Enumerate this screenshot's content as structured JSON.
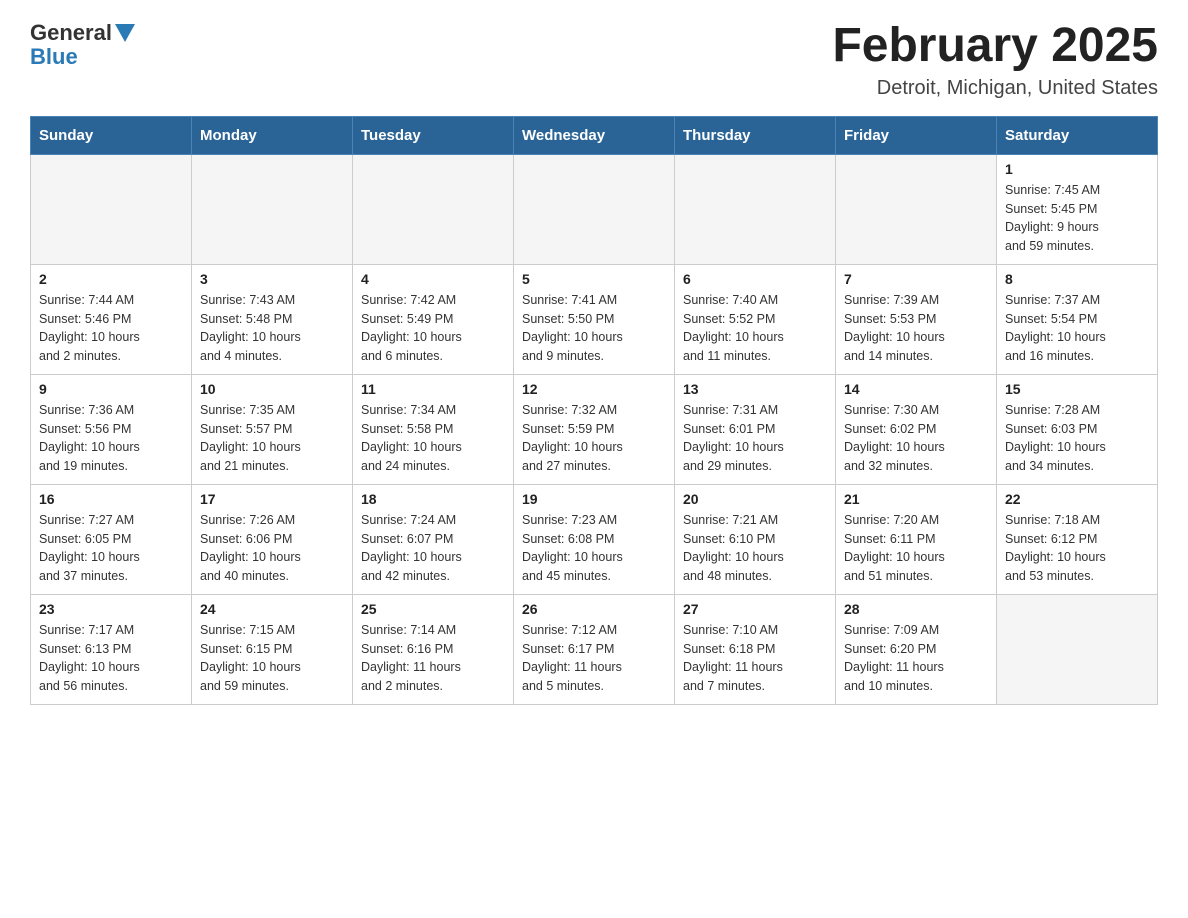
{
  "logo": {
    "general": "General",
    "blue": "Blue"
  },
  "header": {
    "title": "February 2025",
    "location": "Detroit, Michigan, United States"
  },
  "weekdays": [
    "Sunday",
    "Monday",
    "Tuesday",
    "Wednesday",
    "Thursday",
    "Friday",
    "Saturday"
  ],
  "weeks": [
    [
      {
        "day": "",
        "info": ""
      },
      {
        "day": "",
        "info": ""
      },
      {
        "day": "",
        "info": ""
      },
      {
        "day": "",
        "info": ""
      },
      {
        "day": "",
        "info": ""
      },
      {
        "day": "",
        "info": ""
      },
      {
        "day": "1",
        "info": "Sunrise: 7:45 AM\nSunset: 5:45 PM\nDaylight: 9 hours\nand 59 minutes."
      }
    ],
    [
      {
        "day": "2",
        "info": "Sunrise: 7:44 AM\nSunset: 5:46 PM\nDaylight: 10 hours\nand 2 minutes."
      },
      {
        "day": "3",
        "info": "Sunrise: 7:43 AM\nSunset: 5:48 PM\nDaylight: 10 hours\nand 4 minutes."
      },
      {
        "day": "4",
        "info": "Sunrise: 7:42 AM\nSunset: 5:49 PM\nDaylight: 10 hours\nand 6 minutes."
      },
      {
        "day": "5",
        "info": "Sunrise: 7:41 AM\nSunset: 5:50 PM\nDaylight: 10 hours\nand 9 minutes."
      },
      {
        "day": "6",
        "info": "Sunrise: 7:40 AM\nSunset: 5:52 PM\nDaylight: 10 hours\nand 11 minutes."
      },
      {
        "day": "7",
        "info": "Sunrise: 7:39 AM\nSunset: 5:53 PM\nDaylight: 10 hours\nand 14 minutes."
      },
      {
        "day": "8",
        "info": "Sunrise: 7:37 AM\nSunset: 5:54 PM\nDaylight: 10 hours\nand 16 minutes."
      }
    ],
    [
      {
        "day": "9",
        "info": "Sunrise: 7:36 AM\nSunset: 5:56 PM\nDaylight: 10 hours\nand 19 minutes."
      },
      {
        "day": "10",
        "info": "Sunrise: 7:35 AM\nSunset: 5:57 PM\nDaylight: 10 hours\nand 21 minutes."
      },
      {
        "day": "11",
        "info": "Sunrise: 7:34 AM\nSunset: 5:58 PM\nDaylight: 10 hours\nand 24 minutes."
      },
      {
        "day": "12",
        "info": "Sunrise: 7:32 AM\nSunset: 5:59 PM\nDaylight: 10 hours\nand 27 minutes."
      },
      {
        "day": "13",
        "info": "Sunrise: 7:31 AM\nSunset: 6:01 PM\nDaylight: 10 hours\nand 29 minutes."
      },
      {
        "day": "14",
        "info": "Sunrise: 7:30 AM\nSunset: 6:02 PM\nDaylight: 10 hours\nand 32 minutes."
      },
      {
        "day": "15",
        "info": "Sunrise: 7:28 AM\nSunset: 6:03 PM\nDaylight: 10 hours\nand 34 minutes."
      }
    ],
    [
      {
        "day": "16",
        "info": "Sunrise: 7:27 AM\nSunset: 6:05 PM\nDaylight: 10 hours\nand 37 minutes."
      },
      {
        "day": "17",
        "info": "Sunrise: 7:26 AM\nSunset: 6:06 PM\nDaylight: 10 hours\nand 40 minutes."
      },
      {
        "day": "18",
        "info": "Sunrise: 7:24 AM\nSunset: 6:07 PM\nDaylight: 10 hours\nand 42 minutes."
      },
      {
        "day": "19",
        "info": "Sunrise: 7:23 AM\nSunset: 6:08 PM\nDaylight: 10 hours\nand 45 minutes."
      },
      {
        "day": "20",
        "info": "Sunrise: 7:21 AM\nSunset: 6:10 PM\nDaylight: 10 hours\nand 48 minutes."
      },
      {
        "day": "21",
        "info": "Sunrise: 7:20 AM\nSunset: 6:11 PM\nDaylight: 10 hours\nand 51 minutes."
      },
      {
        "day": "22",
        "info": "Sunrise: 7:18 AM\nSunset: 6:12 PM\nDaylight: 10 hours\nand 53 minutes."
      }
    ],
    [
      {
        "day": "23",
        "info": "Sunrise: 7:17 AM\nSunset: 6:13 PM\nDaylight: 10 hours\nand 56 minutes."
      },
      {
        "day": "24",
        "info": "Sunrise: 7:15 AM\nSunset: 6:15 PM\nDaylight: 10 hours\nand 59 minutes."
      },
      {
        "day": "25",
        "info": "Sunrise: 7:14 AM\nSunset: 6:16 PM\nDaylight: 11 hours\nand 2 minutes."
      },
      {
        "day": "26",
        "info": "Sunrise: 7:12 AM\nSunset: 6:17 PM\nDaylight: 11 hours\nand 5 minutes."
      },
      {
        "day": "27",
        "info": "Sunrise: 7:10 AM\nSunset: 6:18 PM\nDaylight: 11 hours\nand 7 minutes."
      },
      {
        "day": "28",
        "info": "Sunrise: 7:09 AM\nSunset: 6:20 PM\nDaylight: 11 hours\nand 10 minutes."
      },
      {
        "day": "",
        "info": ""
      }
    ]
  ]
}
